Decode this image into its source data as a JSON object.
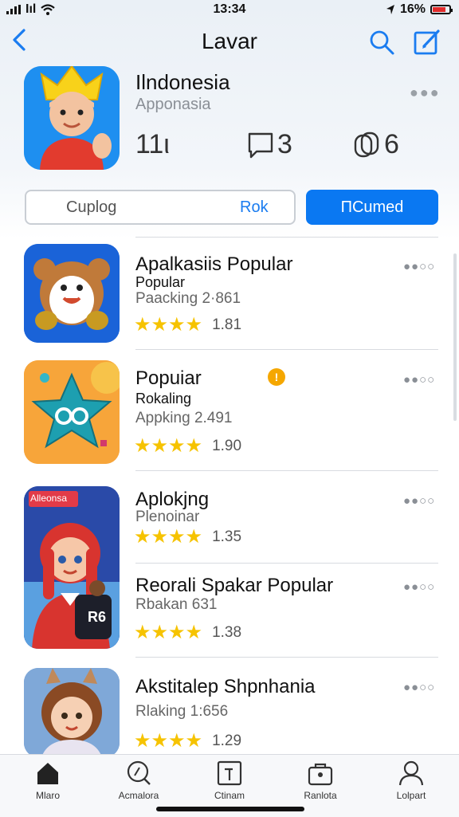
{
  "status": {
    "carrier": "Iıl",
    "time": "13:34",
    "battery": "16%"
  },
  "nav": {
    "back_icon": "chevron-left-icon",
    "title": "Lavar",
    "search_icon": "search-icon",
    "edit_icon": "edit-icon"
  },
  "hero": {
    "title": "Ilndonesia",
    "subtitle": "Apponasia",
    "stats": {
      "likes": "11ι",
      "comments": "3",
      "shares": "6"
    }
  },
  "segments": {
    "left_label": "Cuplog",
    "right_label": "Rok",
    "active_label": "ПCumed"
  },
  "apps": [
    {
      "name": "Apalkasiis Popular",
      "line1": "Popular",
      "line2": "Paacking 2·861",
      "rating": "1.81"
    },
    {
      "name": "Popuiar",
      "line1": "Rokaling",
      "line2": "Appking 2.491",
      "rating": "1.90",
      "badge": "!"
    },
    {
      "name": "Aplokjng",
      "line1": "Plenoinar",
      "line2": "",
      "rating": "1.35",
      "icon_label": "Alleonsa"
    },
    {
      "name": "Reorali Spakar Popular",
      "line1": "Rbakan 631",
      "line2": "",
      "rating": "1.38",
      "icon_label": "R6"
    },
    {
      "name": "Akstitalep Shpnhania",
      "line1": "Rlaking 1:656",
      "line2": "",
      "rating": "1.29"
    }
  ],
  "tabs": [
    {
      "label": "Mlaro",
      "icon": "home-icon"
    },
    {
      "label": "Acmalora",
      "icon": "search-icon"
    },
    {
      "label": "Ctinam",
      "icon": "add-square-icon"
    },
    {
      "label": "Ranlota",
      "icon": "bag-icon"
    },
    {
      "label": "Lolpart",
      "icon": "person-icon"
    }
  ],
  "colors": {
    "accent": "#0a78f2",
    "star": "#f6c300"
  }
}
